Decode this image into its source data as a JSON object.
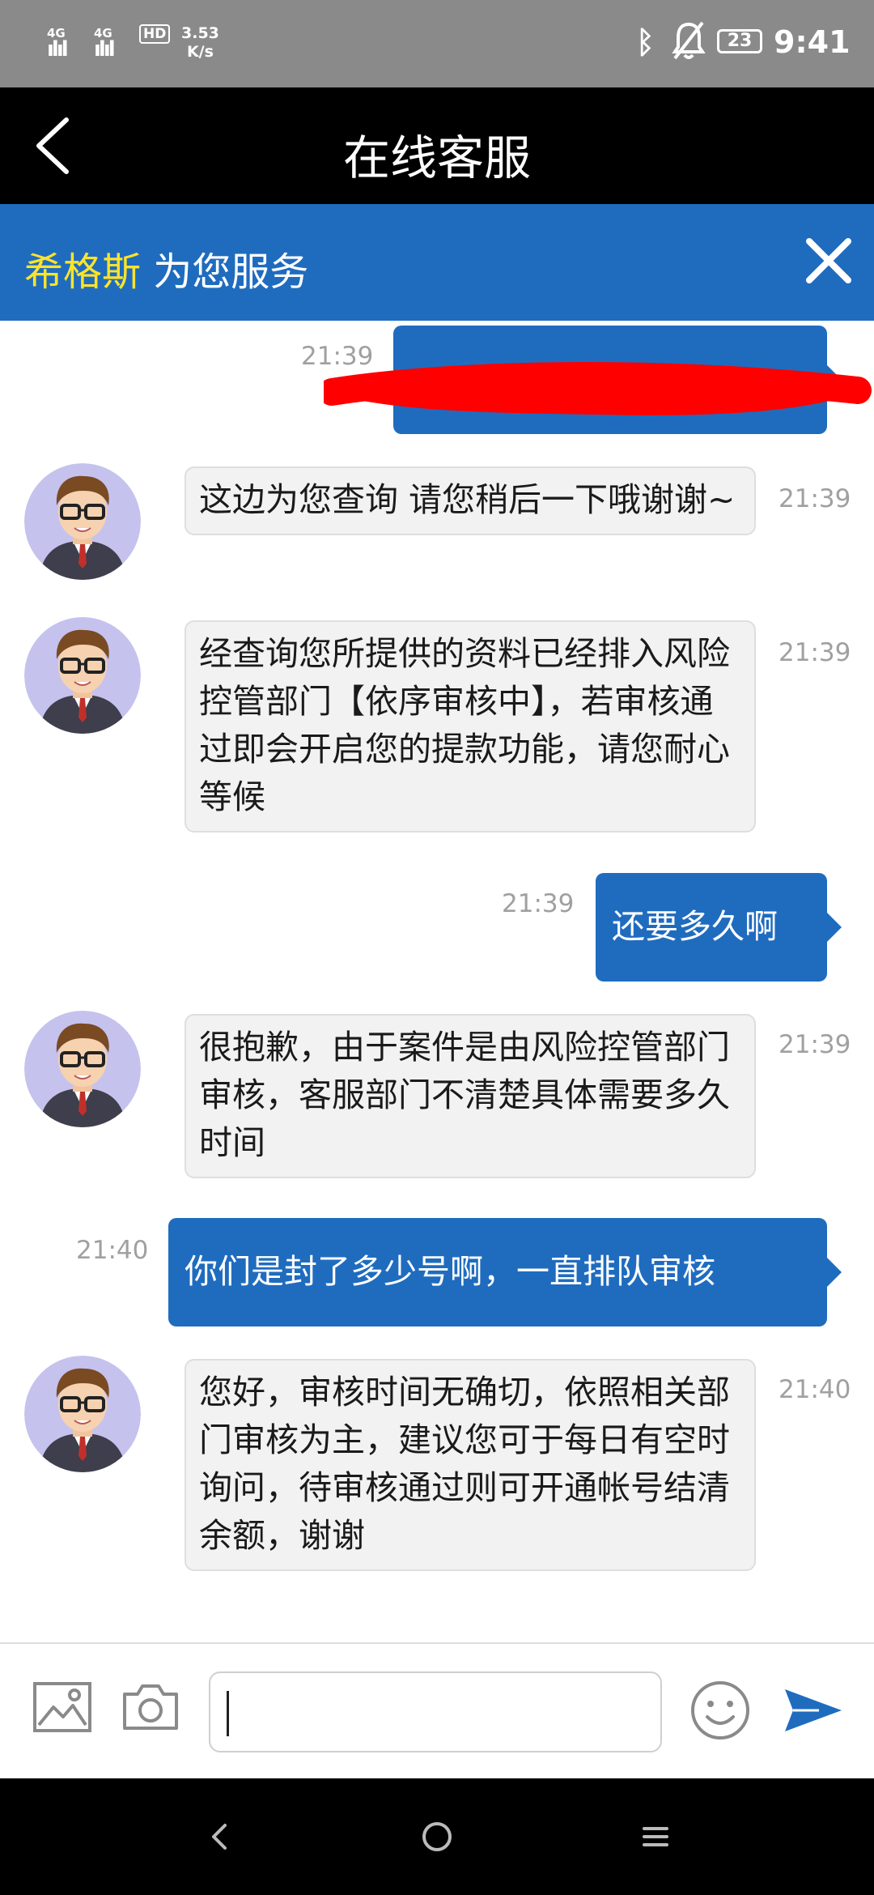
{
  "status_bar": {
    "network_1": "4G",
    "network_2": "4G",
    "sim_label": "HD",
    "speed_value": "3.53",
    "speed_unit": "K/s",
    "battery": "23",
    "time": "9:41"
  },
  "header": {
    "title": "在线客服"
  },
  "agent_bar": {
    "agent_name": "希格斯",
    "serving_text": " 为您服务"
  },
  "messages": [
    {
      "from": "user",
      "time": "21:39",
      "text": ""
    },
    {
      "from": "agent",
      "time": "21:39",
      "text": "这边为您查询 请您稍后一下哦谢谢~"
    },
    {
      "from": "agent",
      "time": "21:39",
      "text": "经查询您所提供的资料已经排入风险控管部门【依序审核中】，若审核通过即会开启您的提款功能，请您耐心等候"
    },
    {
      "from": "user",
      "time": "21:39",
      "text": "还要多久啊"
    },
    {
      "from": "agent",
      "time": "21:39",
      "text": "很抱歉，由于案件是由风险控管部门审核，客服部门不清楚具体需要多久时间"
    },
    {
      "from": "user",
      "time": "21:40",
      "text": "你们是封了多少号啊，一直排队审核"
    },
    {
      "from": "agent",
      "time": "21:40",
      "text": "您好，审核时间无确切，依照相关部门审核为主，建议您可于每日有空时询问，待审核通过则可开通帐号结清余额，谢谢"
    }
  ],
  "input_bar": {
    "message_value": "",
    "placeholder": ""
  },
  "icons": {
    "back": "chevron-left-icon",
    "close": "close-icon",
    "image": "image-icon",
    "camera": "camera-icon",
    "emoji": "smiley-icon",
    "send": "send-icon"
  },
  "colors": {
    "header_bg": "#000000",
    "agent_bar_bg": "#1f6cbf",
    "agent_name": "#ffe32a",
    "user_bubble": "#1f6cbf",
    "agent_bubble": "#f2f2f2",
    "redaction": "#ff0000"
  }
}
